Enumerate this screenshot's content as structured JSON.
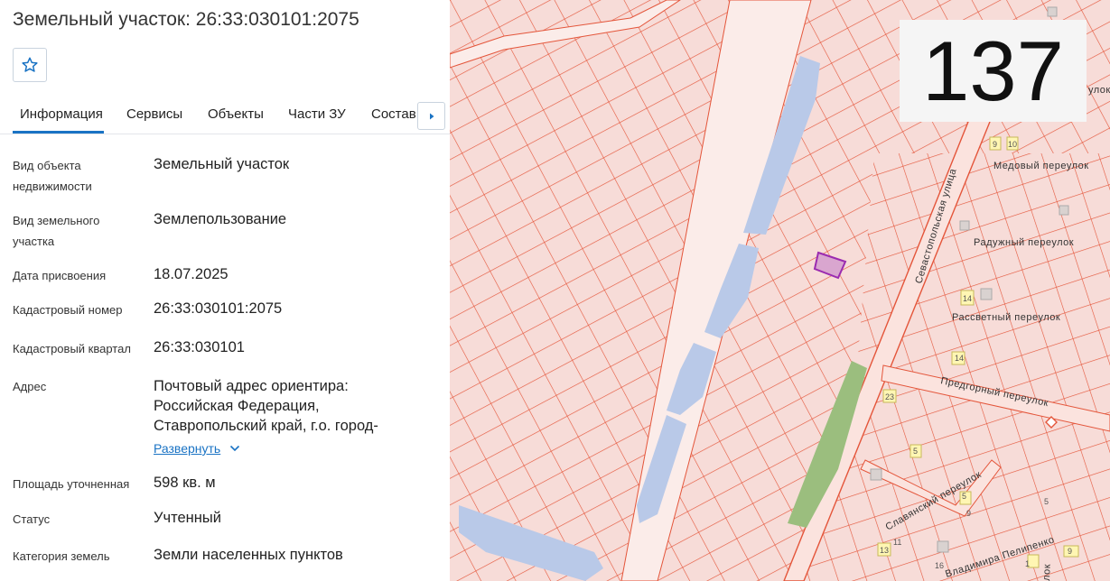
{
  "panel": {
    "title": "Земельный участок: 26:33:030101:2075",
    "tabs": [
      {
        "label": "Информация",
        "active": true
      },
      {
        "label": "Сервисы"
      },
      {
        "label": "Объекты"
      },
      {
        "label": "Части ЗУ"
      },
      {
        "label": "Состав"
      }
    ],
    "fields": [
      {
        "label": "Вид объекта недвижимости",
        "value": "Земельный участок"
      },
      {
        "label": "Вид земельного участка",
        "value": "Землепользование"
      },
      {
        "label": "Дата присвоения",
        "value": "18.07.2025"
      },
      {
        "label": "Кадастровый номер",
        "value": "26:33:030101:2075"
      },
      {
        "label": "Кадастровый квартал",
        "value": "26:33:030101"
      },
      {
        "label": "Адрес",
        "value": "Почтовый адрес ориентира: Российская Федерация, Ставропольский край, г.о. город-"
      },
      {
        "label": "Площадь уточненная",
        "value": "598 кв. м"
      },
      {
        "label": "Статус",
        "value": "Учтенный"
      },
      {
        "label": "Категория земель",
        "value": "Земли населенных пунктов"
      }
    ],
    "expand_label": "Развернуть"
  },
  "map": {
    "counter": "137",
    "labels": {
      "street_sevastopol": "Севастопольская улица",
      "medovy": "Медовый переулок",
      "raduzhny": "Радужный переулок",
      "rassvetny": "Рассветный переулок",
      "predgorny": "Предгорный переулок",
      "slavyansky": "Славянский переулок",
      "pelipenko": "Владимира Пелипенко",
      "lok": "лок",
      "ulok": "улок",
      "n9": "9",
      "n10": "10",
      "n14a": "14",
      "n14b": "14",
      "n23": "23",
      "n5a": "5",
      "n5b": "5",
      "n5c": "5",
      "n9b": "9",
      "n13": "13",
      "n11": "11",
      "n16": "16",
      "n1": "1",
      "n9c": "9"
    },
    "colors": {
      "parcel_fill": "#f7dcd8",
      "parcel_border": "#e4553a",
      "water": "#b9c9e8",
      "green": "#9bbe7e",
      "selected": "#9b2bb0"
    }
  }
}
